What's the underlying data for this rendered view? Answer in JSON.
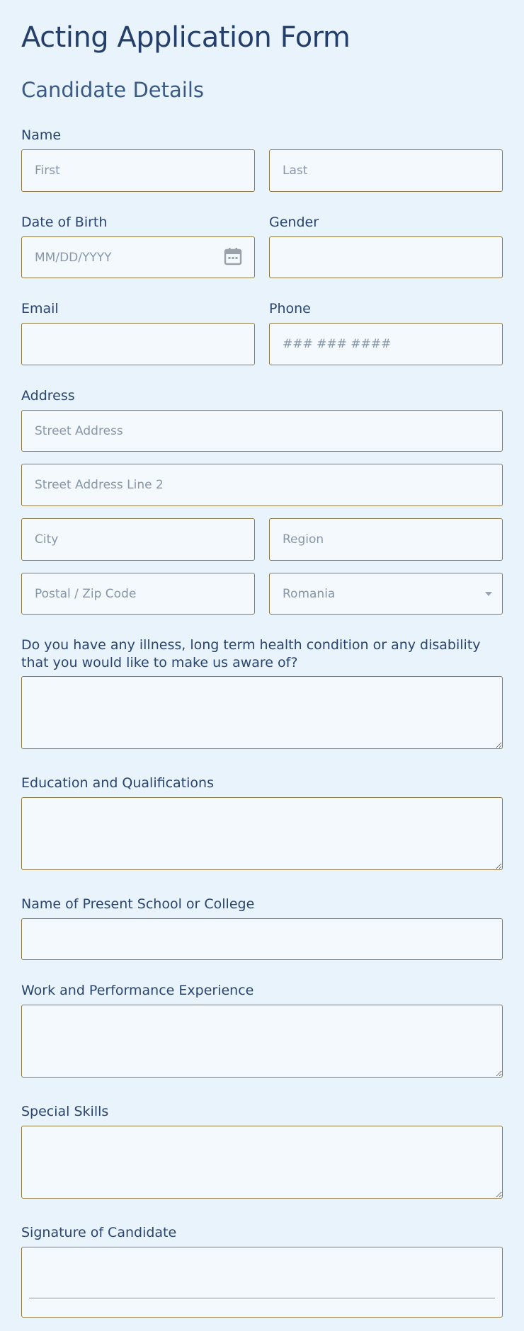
{
  "form": {
    "title": "Acting Application Form",
    "section_title": "Candidate Details"
  },
  "fields": {
    "name": {
      "label": "Name",
      "first_placeholder": "First",
      "last_placeholder": "Last"
    },
    "dob": {
      "label": "Date of Birth",
      "placeholder": "MM/DD/YYYY",
      "icon": "calendar-icon"
    },
    "gender": {
      "label": "Gender",
      "value": ""
    },
    "email": {
      "label": "Email",
      "value": ""
    },
    "phone": {
      "label": "Phone",
      "placeholder": "### ### ####"
    },
    "address": {
      "label": "Address",
      "street_placeholder": "Street Address",
      "street2_placeholder": "Street Address Line 2",
      "city_placeholder": "City",
      "region_placeholder": "Region",
      "postal_placeholder": "Postal / Zip Code",
      "country_selected": "Romania"
    },
    "health": {
      "label": "Do you have any illness, long term health condition or any disability that you would like to make us aware of?"
    },
    "education": {
      "label": "Education and Qualifications"
    },
    "school": {
      "label": "Name of Present School or College"
    },
    "experience": {
      "label": "Work and Performance Experience"
    },
    "skills": {
      "label": "Special Skills"
    },
    "signature": {
      "label": "Signature of Candidate"
    }
  },
  "colors": {
    "background": "#e8f3fb",
    "field_background": "#f4f9fd",
    "field_border": "#8d7a45",
    "title": "#243f6b",
    "label": "#2a4470",
    "placeholder": "#8796ab"
  }
}
